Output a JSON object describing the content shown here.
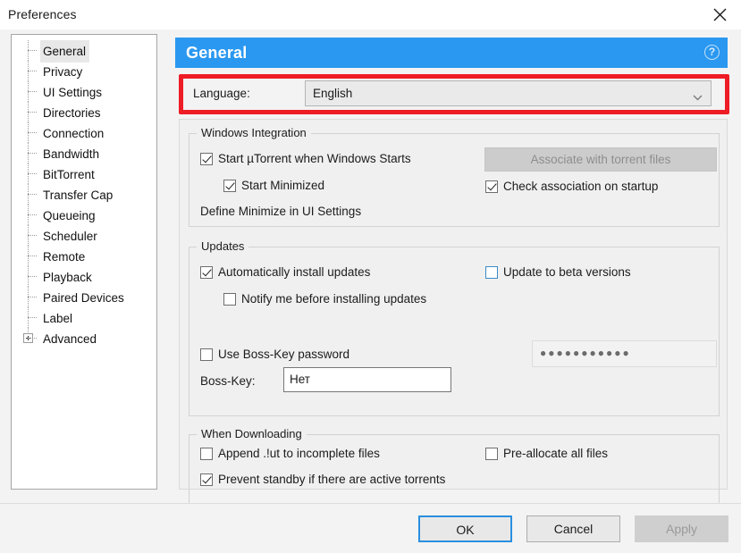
{
  "window": {
    "title": "Preferences",
    "close_icon": "close-icon"
  },
  "sidebar": {
    "items": [
      {
        "label": "General",
        "selected": true,
        "expandable": false
      },
      {
        "label": "Privacy",
        "selected": false,
        "expandable": false
      },
      {
        "label": "UI Settings",
        "selected": false,
        "expandable": false
      },
      {
        "label": "Directories",
        "selected": false,
        "expandable": false
      },
      {
        "label": "Connection",
        "selected": false,
        "expandable": false
      },
      {
        "label": "Bandwidth",
        "selected": false,
        "expandable": false
      },
      {
        "label": "BitTorrent",
        "selected": false,
        "expandable": false
      },
      {
        "label": "Transfer Cap",
        "selected": false,
        "expandable": false
      },
      {
        "label": "Queueing",
        "selected": false,
        "expandable": false
      },
      {
        "label": "Scheduler",
        "selected": false,
        "expandable": false
      },
      {
        "label": "Remote",
        "selected": false,
        "expandable": false
      },
      {
        "label": "Playback",
        "selected": false,
        "expandable": false
      },
      {
        "label": "Paired Devices",
        "selected": false,
        "expandable": false
      },
      {
        "label": "Label",
        "selected": false,
        "expandable": false
      },
      {
        "label": "Advanced",
        "selected": false,
        "expandable": true
      }
    ]
  },
  "header": {
    "title": "General",
    "help_icon": "?"
  },
  "language": {
    "label": "Language:",
    "value": "English",
    "chevron_icon": "chevron-down-icon"
  },
  "annotation": {
    "color": "#ee1c25",
    "target": "language-row"
  },
  "windows_integration": {
    "title": "Windows Integration",
    "start_with_windows": {
      "label": "Start µTorrent when Windows Starts",
      "checked": true
    },
    "start_minimized": {
      "label": "Start Minimized",
      "checked": true
    },
    "define_minimize_note": "Define Minimize in UI Settings",
    "associate_button": {
      "label": "Associate with torrent files",
      "disabled": true
    },
    "check_association": {
      "label": "Check association on startup",
      "checked": true
    }
  },
  "updates": {
    "title": "Updates",
    "auto_install": {
      "label": "Automatically install updates",
      "checked": true
    },
    "notify_before": {
      "label": "Notify me before installing updates",
      "checked": false
    },
    "beta_versions": {
      "label": "Update to beta versions",
      "checked": false
    },
    "use_boss_key_password": {
      "label": "Use Boss-Key password",
      "checked": false
    },
    "boss_key_label": "Boss-Key:",
    "boss_key_value": "Нет",
    "password_value": "●●●●●●●●●●●",
    "password_disabled": true
  },
  "when_downloading": {
    "title": "When Downloading",
    "append_ut": {
      "label": "Append .!ut to incomplete files",
      "checked": false
    },
    "preallocate": {
      "label": "Pre-allocate all files",
      "checked": false
    },
    "prevent_standby": {
      "label": "Prevent standby if there are active torrents",
      "checked": true
    }
  },
  "footer": {
    "ok": "OK",
    "cancel": "Cancel",
    "apply": "Apply",
    "apply_disabled": true
  },
  "colors": {
    "header_blue": "#2a98f0",
    "annotation_red": "#ee1c25",
    "focus_blue": "#2a8fe0"
  }
}
